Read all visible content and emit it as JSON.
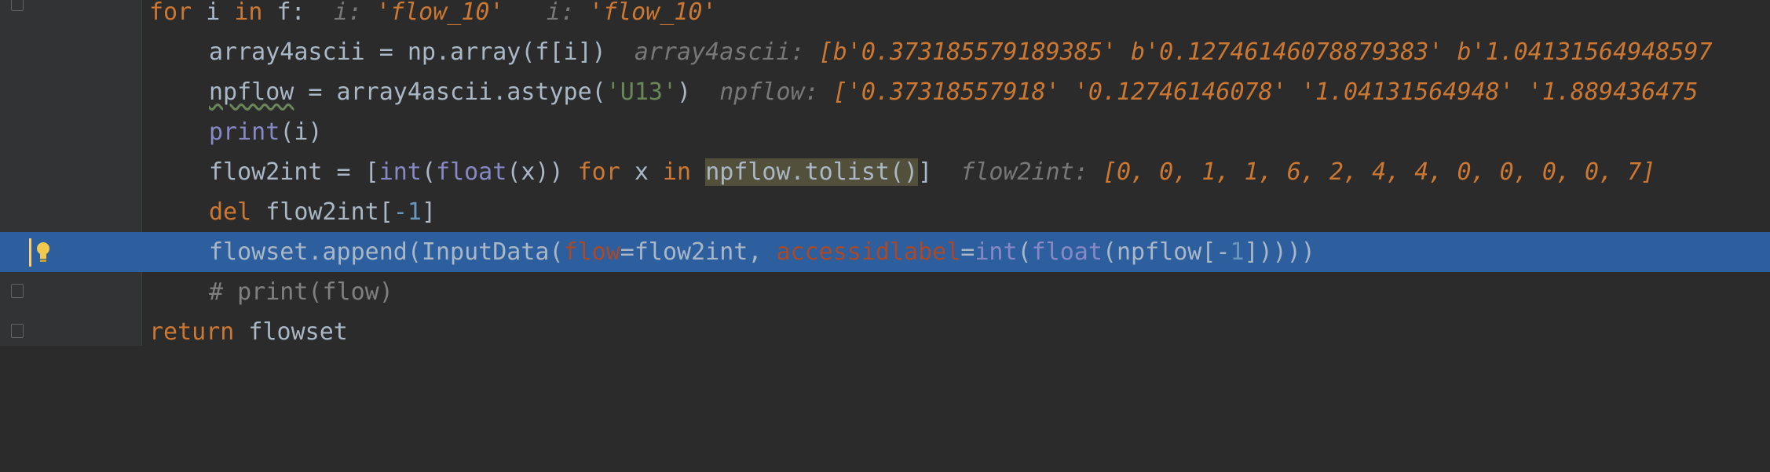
{
  "editor": {
    "colors": {
      "background": "#2b2b2b",
      "gutter": "#313335",
      "highlight": "#2d5e9e",
      "keyword": "#cc7832",
      "builtin": "#8888c6",
      "parameter": "#aa4926",
      "inlay_hint": "#787878"
    },
    "lines": {
      "l1": {
        "kw_for": "for",
        "t1": " i ",
        "kw_in": "in",
        "t2": " f:",
        "h1_name": "i:",
        "h1_val": "'flow_10'",
        "h2_name": "i:",
        "h2_val": "'flow_10'"
      },
      "l2": {
        "t1": "array4ascii = np.array(f[i])",
        "hint_name": "array4ascii:",
        "hint_val": "[b'0.373185579189385' b'0.12746146078879383' b'1.04131564948597"
      },
      "l3": {
        "var": "npflow",
        "t1": " = array4ascii.astype(",
        "str": "'U13'",
        "t2": ")",
        "hint_name": "npflow:",
        "hint_val": "['0.37318557918' '0.12746146078' '1.04131564948' '1.889436475"
      },
      "l4": {
        "fn": "print",
        "t1": "(i)"
      },
      "l5": {
        "t1": "flow2int = [",
        "fn1": "int",
        "t2": "(",
        "fn2": "float",
        "t3": "(x)) ",
        "kw_for": "for",
        "t4": " x ",
        "kw_in": "in",
        "t5": " ",
        "sel": "npflow.tolist()",
        "t6": "]",
        "hint_name": "flow2int:",
        "hint_val": "[0, 0, 1, 1, 6, 2, 4, 4, 0, 0, 0, 0, 7]"
      },
      "l6": {
        "kw_del": "del",
        "t1": " flow2int[",
        "minus": "-",
        "num": "1",
        "t2": "]"
      },
      "l7": {
        "t1": "flowset.append(InputData(",
        "p1": "flow",
        "t2": "=flow2int, ",
        "p2": "accessidlabel",
        "t3": "=",
        "fn1": "int",
        "t4": "(",
        "fn2": "float",
        "t5": "(npflow[-",
        "num": "1",
        "t6": "]))))"
      },
      "l8": {
        "comment": "# print(flow)"
      },
      "l9": {
        "kw_return": "return",
        "t1": " flowset"
      }
    },
    "icons": {
      "intention": "lightbulb-icon",
      "fold": "fold-marker-icon"
    }
  }
}
